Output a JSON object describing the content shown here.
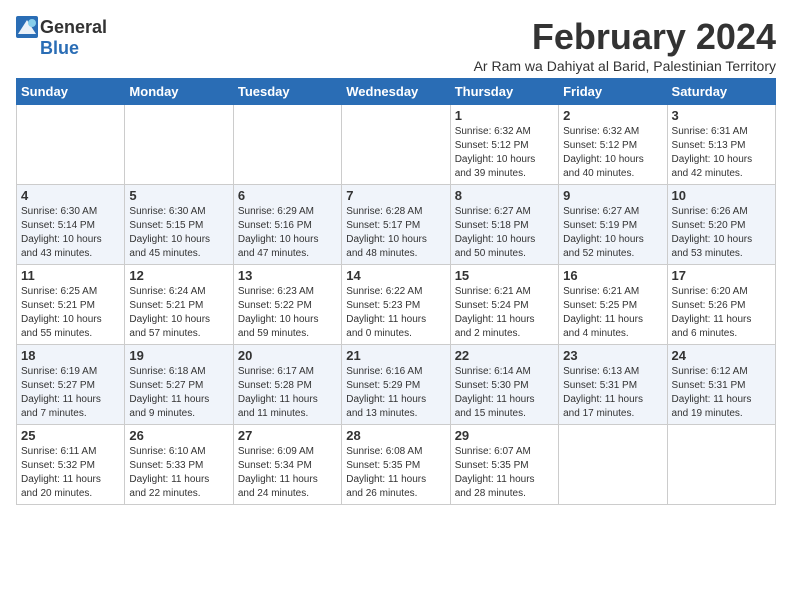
{
  "logo": {
    "general": "General",
    "blue": "Blue"
  },
  "title": "February 2024",
  "subtitle": "Ar Ram wa Dahiyat al Barid, Palestinian Territory",
  "headers": [
    "Sunday",
    "Monday",
    "Tuesday",
    "Wednesday",
    "Thursday",
    "Friday",
    "Saturday"
  ],
  "weeks": [
    [
      {
        "day": "",
        "info": ""
      },
      {
        "day": "",
        "info": ""
      },
      {
        "day": "",
        "info": ""
      },
      {
        "day": "",
        "info": ""
      },
      {
        "day": "1",
        "info": "Sunrise: 6:32 AM\nSunset: 5:12 PM\nDaylight: 10 hours\nand 39 minutes."
      },
      {
        "day": "2",
        "info": "Sunrise: 6:32 AM\nSunset: 5:12 PM\nDaylight: 10 hours\nand 40 minutes."
      },
      {
        "day": "3",
        "info": "Sunrise: 6:31 AM\nSunset: 5:13 PM\nDaylight: 10 hours\nand 42 minutes."
      }
    ],
    [
      {
        "day": "4",
        "info": "Sunrise: 6:30 AM\nSunset: 5:14 PM\nDaylight: 10 hours\nand 43 minutes."
      },
      {
        "day": "5",
        "info": "Sunrise: 6:30 AM\nSunset: 5:15 PM\nDaylight: 10 hours\nand 45 minutes."
      },
      {
        "day": "6",
        "info": "Sunrise: 6:29 AM\nSunset: 5:16 PM\nDaylight: 10 hours\nand 47 minutes."
      },
      {
        "day": "7",
        "info": "Sunrise: 6:28 AM\nSunset: 5:17 PM\nDaylight: 10 hours\nand 48 minutes."
      },
      {
        "day": "8",
        "info": "Sunrise: 6:27 AM\nSunset: 5:18 PM\nDaylight: 10 hours\nand 50 minutes."
      },
      {
        "day": "9",
        "info": "Sunrise: 6:27 AM\nSunset: 5:19 PM\nDaylight: 10 hours\nand 52 minutes."
      },
      {
        "day": "10",
        "info": "Sunrise: 6:26 AM\nSunset: 5:20 PM\nDaylight: 10 hours\nand 53 minutes."
      }
    ],
    [
      {
        "day": "11",
        "info": "Sunrise: 6:25 AM\nSunset: 5:21 PM\nDaylight: 10 hours\nand 55 minutes."
      },
      {
        "day": "12",
        "info": "Sunrise: 6:24 AM\nSunset: 5:21 PM\nDaylight: 10 hours\nand 57 minutes."
      },
      {
        "day": "13",
        "info": "Sunrise: 6:23 AM\nSunset: 5:22 PM\nDaylight: 10 hours\nand 59 minutes."
      },
      {
        "day": "14",
        "info": "Sunrise: 6:22 AM\nSunset: 5:23 PM\nDaylight: 11 hours\nand 0 minutes."
      },
      {
        "day": "15",
        "info": "Sunrise: 6:21 AM\nSunset: 5:24 PM\nDaylight: 11 hours\nand 2 minutes."
      },
      {
        "day": "16",
        "info": "Sunrise: 6:21 AM\nSunset: 5:25 PM\nDaylight: 11 hours\nand 4 minutes."
      },
      {
        "day": "17",
        "info": "Sunrise: 6:20 AM\nSunset: 5:26 PM\nDaylight: 11 hours\nand 6 minutes."
      }
    ],
    [
      {
        "day": "18",
        "info": "Sunrise: 6:19 AM\nSunset: 5:27 PM\nDaylight: 11 hours\nand 7 minutes."
      },
      {
        "day": "19",
        "info": "Sunrise: 6:18 AM\nSunset: 5:27 PM\nDaylight: 11 hours\nand 9 minutes."
      },
      {
        "day": "20",
        "info": "Sunrise: 6:17 AM\nSunset: 5:28 PM\nDaylight: 11 hours\nand 11 minutes."
      },
      {
        "day": "21",
        "info": "Sunrise: 6:16 AM\nSunset: 5:29 PM\nDaylight: 11 hours\nand 13 minutes."
      },
      {
        "day": "22",
        "info": "Sunrise: 6:14 AM\nSunset: 5:30 PM\nDaylight: 11 hours\nand 15 minutes."
      },
      {
        "day": "23",
        "info": "Sunrise: 6:13 AM\nSunset: 5:31 PM\nDaylight: 11 hours\nand 17 minutes."
      },
      {
        "day": "24",
        "info": "Sunrise: 6:12 AM\nSunset: 5:31 PM\nDaylight: 11 hours\nand 19 minutes."
      }
    ],
    [
      {
        "day": "25",
        "info": "Sunrise: 6:11 AM\nSunset: 5:32 PM\nDaylight: 11 hours\nand 20 minutes."
      },
      {
        "day": "26",
        "info": "Sunrise: 6:10 AM\nSunset: 5:33 PM\nDaylight: 11 hours\nand 22 minutes."
      },
      {
        "day": "27",
        "info": "Sunrise: 6:09 AM\nSunset: 5:34 PM\nDaylight: 11 hours\nand 24 minutes."
      },
      {
        "day": "28",
        "info": "Sunrise: 6:08 AM\nSunset: 5:35 PM\nDaylight: 11 hours\nand 26 minutes."
      },
      {
        "day": "29",
        "info": "Sunrise: 6:07 AM\nSunset: 5:35 PM\nDaylight: 11 hours\nand 28 minutes."
      },
      {
        "day": "",
        "info": ""
      },
      {
        "day": "",
        "info": ""
      }
    ]
  ]
}
